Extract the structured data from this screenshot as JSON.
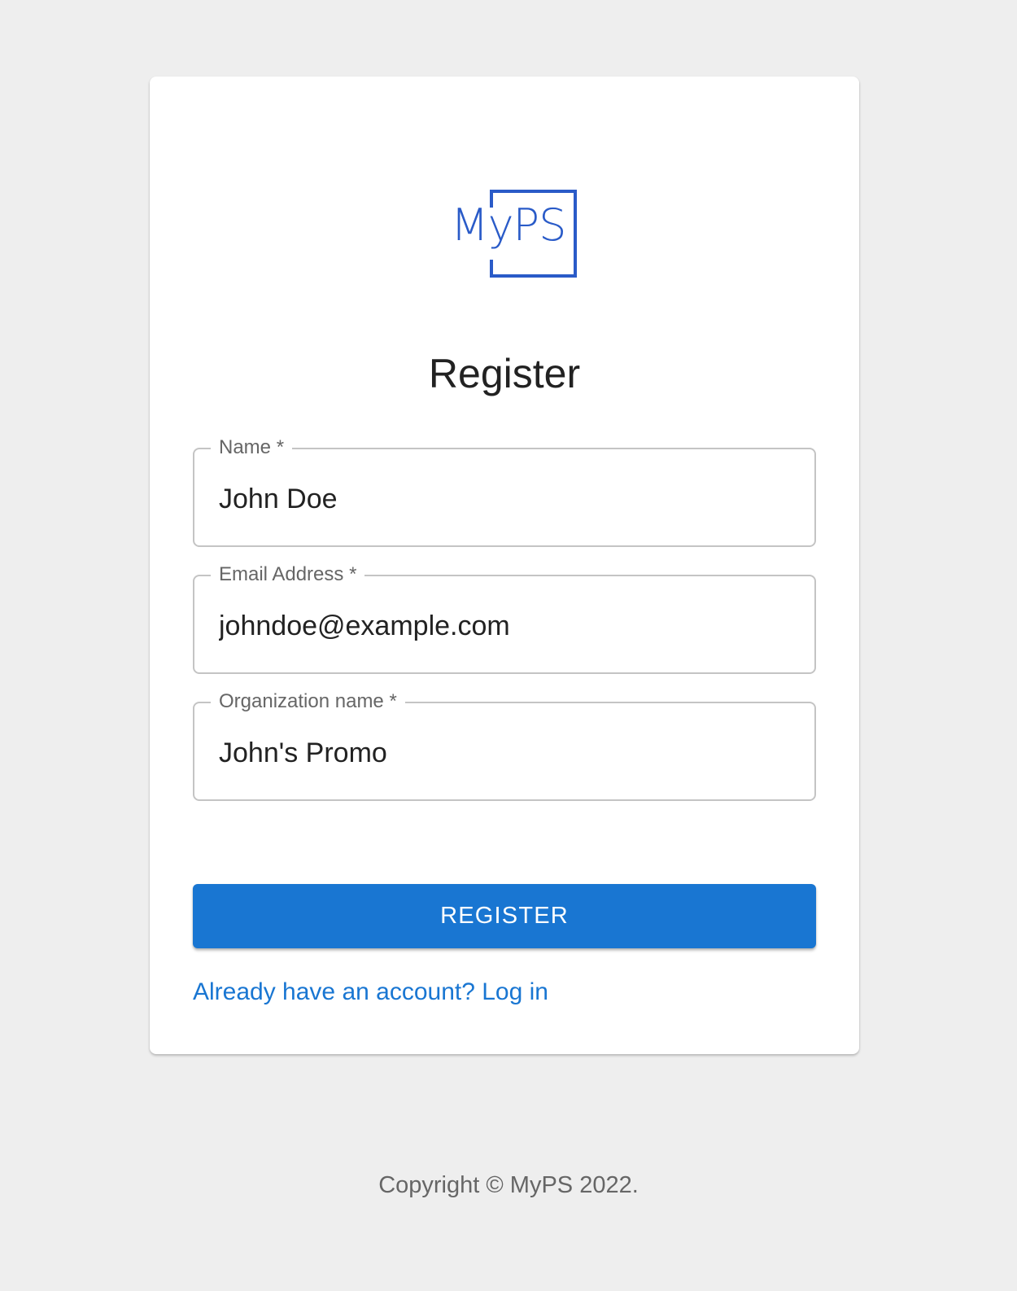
{
  "logo": {
    "text": "MyPS"
  },
  "form": {
    "title": "Register",
    "fields": [
      {
        "label": "Name *",
        "value": "John Doe"
      },
      {
        "label": "Email Address *",
        "value": "johndoe@example.com"
      },
      {
        "label": "Organization name *",
        "value": "John's Promo"
      }
    ],
    "submit_label": "REGISTER",
    "login_link": "Already have an account? Log in"
  },
  "footer": {
    "copyright": "Copyright © MyPS 2022."
  },
  "colors": {
    "brand": "#2a5bc8",
    "primary": "#1976d2",
    "background": "#eeeeee"
  }
}
